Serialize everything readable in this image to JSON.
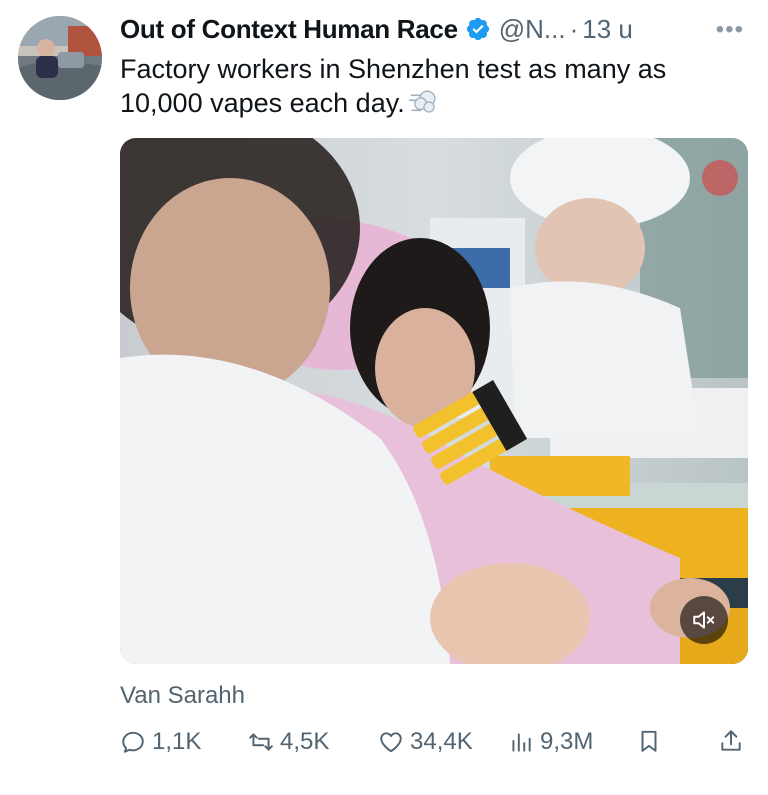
{
  "author": {
    "name": "Out of Context Human Race",
    "handle": "@N...",
    "separator": "·",
    "time": "13 u",
    "verified": true,
    "avatar_icon": "avatar-man-in-car-icon"
  },
  "tweet": {
    "text": "Factory workers in Shenzhen test as many as 10,000 vapes each day.",
    "emoji_icon": "dashing-away-icon"
  },
  "media": {
    "type": "video",
    "muted": true,
    "mute_icon": "speaker-muted-icon"
  },
  "attribution": "Van Sarahh",
  "actions": {
    "replies": "1,1K",
    "reposts": "4,5K",
    "likes": "34,4K",
    "views": "9,3M"
  },
  "colors": {
    "accent": "#1d9bf0",
    "text": "#0f1419",
    "secondary": "#536471"
  }
}
